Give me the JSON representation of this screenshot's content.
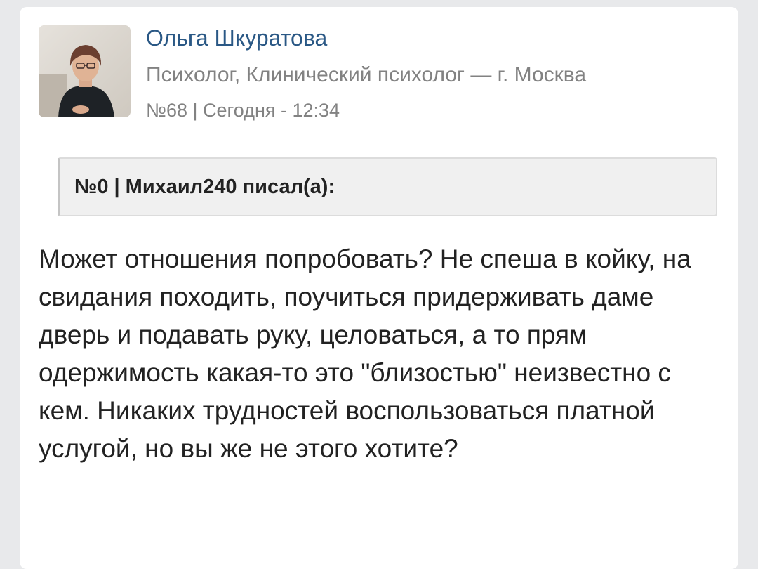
{
  "post": {
    "author": {
      "name": "Ольга Шкуратова",
      "role": "Психолог, Клинический психолог — г. Москва",
      "avatar_icon": "user-photo-avatar"
    },
    "meta": "№68 | Сегодня - 12:34",
    "quote": {
      "header": "№0 | Михаил240 писал(а):"
    },
    "body": "Может отношения попробовать? Не спеша в койку, на свидания походить, поучиться придерживать даме дверь и подавать руку, целоваться, а то прям одержимость какая-то это \"близостью\" неизвестно с кем. Никаких трудностей воспользоваться платной услугой, но вы же не этого хотите?"
  },
  "colors": {
    "author_name": "#2a5885",
    "secondary_text": "#828282",
    "body_text": "#222222",
    "quote_bg": "#f0f0f0",
    "page_bg": "#e8e9eb"
  }
}
